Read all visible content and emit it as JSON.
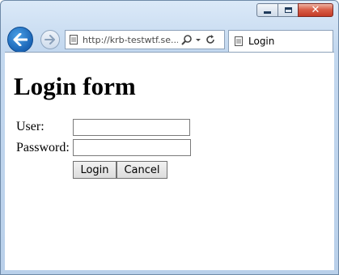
{
  "window": {
    "caption_buttons": {
      "minimize": "minimize-icon",
      "maximize": "maximize-icon",
      "close": "close-icon"
    }
  },
  "toolbar": {
    "back_icon": "back-arrow-icon",
    "forward_icon": "forward-arrow-icon",
    "address": "http://krb-testwtf.se...",
    "search_icon": "search-icon",
    "dropdown_icon": "chevron-down-icon",
    "refresh_icon": "refresh-icon"
  },
  "tab": {
    "title": "Login",
    "icon": "page-icon"
  },
  "page": {
    "heading": "Login form",
    "form": {
      "user_label": "User:",
      "user_value": "",
      "password_label": "Password:",
      "password_value": "",
      "login_button": "Login",
      "cancel_button": "Cancel"
    }
  },
  "colors": {
    "accent": "#1a64b5",
    "close": "#c43b26",
    "chrome": "#c3d8ef"
  }
}
